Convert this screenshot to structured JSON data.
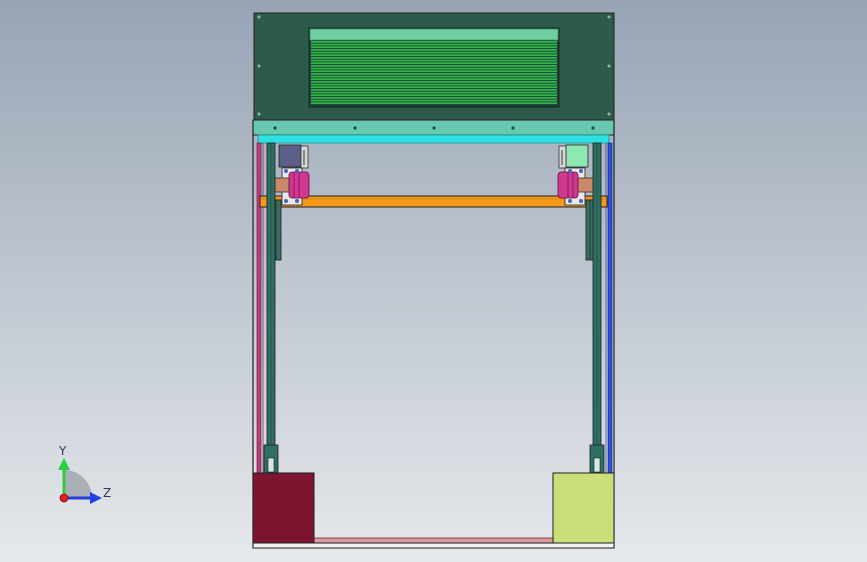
{
  "viewport": {
    "background_top": "#97a4b4",
    "background_bottom": "#e6e9ec"
  },
  "model": {
    "colors": {
      "frame_outline": "#1f1f1f",
      "housing": "#2d5a4b",
      "louver_frame": "#6fcfa1",
      "louver": "#33b54a",
      "top_plate": "#69c9b0",
      "cyan_bar": "#2ee0e0",
      "orange_beam": "#f59a1c",
      "column": "#2f6f63",
      "hub": "#d2378f",
      "bearing_blue": "#4a62b8",
      "block_left": "#7e1530",
      "block_right": "#c9e07a",
      "base_rail": "#d99aa0",
      "left_guide": "#c23b7a",
      "right_guide": "#2e4fe0"
    }
  },
  "triad": {
    "y_label": "Y",
    "z_label": "Z",
    "y_color": "#2ecc40",
    "z_color": "#2040e0",
    "origin_color": "#e02020"
  }
}
